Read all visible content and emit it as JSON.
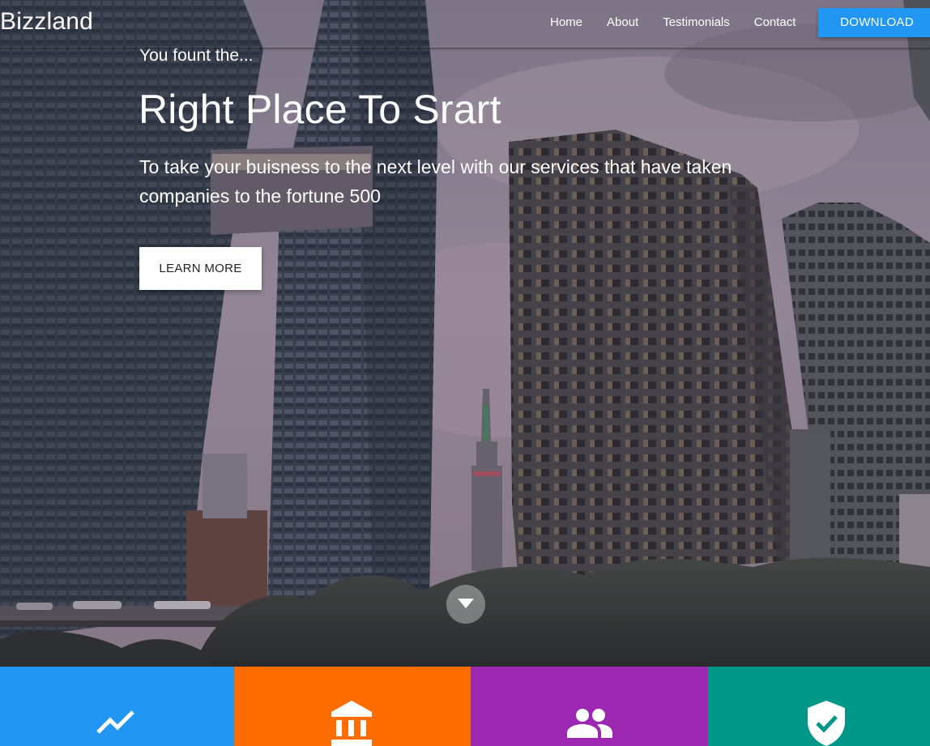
{
  "nav": {
    "brand": "Bizzland",
    "links": [
      "Home",
      "About",
      "Testimonials",
      "Contact"
    ],
    "download_label": "DOWNLOAD",
    "download_color": "#2196f3"
  },
  "hero": {
    "kicker": "You fount the...",
    "headline": "Right Place To Srart",
    "subtext": "To take your buisness to the next level with our services that have taken companies to the fortune 500",
    "cta_label": "LEARN MORE",
    "scroll_icon": "chevron-down-icon"
  },
  "features": {
    "tiles": [
      {
        "icon": "trending-up-icon",
        "color": "#2196f3"
      },
      {
        "icon": "bank-icon",
        "color": "#ff6d00"
      },
      {
        "icon": "people-icon",
        "color": "#9c27b0"
      },
      {
        "icon": "verified-shield-icon",
        "color": "#009688"
      }
    ]
  }
}
